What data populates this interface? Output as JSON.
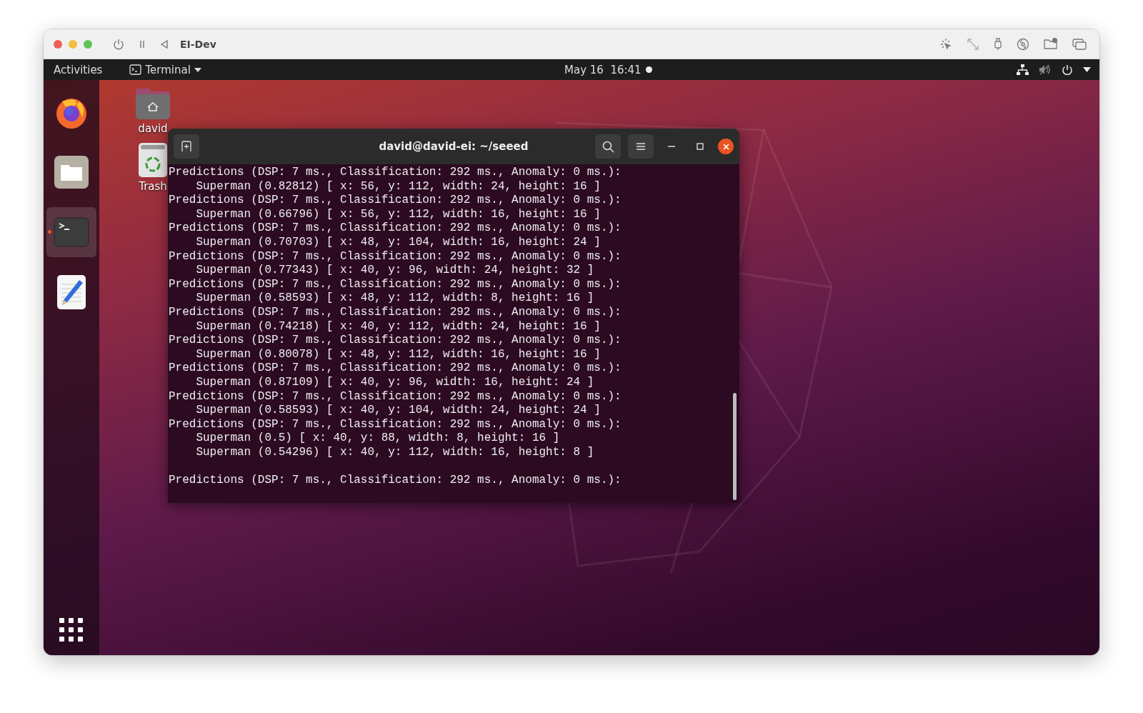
{
  "vm_window": {
    "title": "EI-Dev"
  },
  "top_bar": {
    "activities": "Activities",
    "app_menu": "Terminal",
    "clock": "May 16  16:41"
  },
  "dock": {
    "items": [
      {
        "kind": "browser",
        "selected": false,
        "running": false
      },
      {
        "kind": "files",
        "selected": false,
        "running": false
      },
      {
        "kind": "terminal",
        "selected": true,
        "running": true
      },
      {
        "kind": "editor",
        "selected": false,
        "running": false
      }
    ]
  },
  "desktop_icons": [
    {
      "kind": "home",
      "label": "david"
    },
    {
      "kind": "trash",
      "label": "Trash"
    }
  ],
  "terminal": {
    "title": "david@david-ei: ~/seeed",
    "lines": [
      {
        "text": "Predictions (DSP: 7 ms., Classification: 292 ms., Anomaly: 0 ms.):",
        "blank_before": false
      },
      {
        "text": "    Superman (0.82812) [ x: 56, y: 112, width: 24, height: 16 ]",
        "blank_before": false
      },
      {
        "text": "Predictions (DSP: 7 ms., Classification: 292 ms., Anomaly: 0 ms.):",
        "blank_before": false
      },
      {
        "text": "    Superman (0.66796) [ x: 56, y: 112, width: 16, height: 16 ]",
        "blank_before": false
      },
      {
        "text": "Predictions (DSP: 7 ms., Classification: 292 ms., Anomaly: 0 ms.):",
        "blank_before": false
      },
      {
        "text": "    Superman (0.70703) [ x: 48, y: 104, width: 16, height: 24 ]",
        "blank_before": false
      },
      {
        "text": "Predictions (DSP: 7 ms., Classification: 292 ms., Anomaly: 0 ms.):",
        "blank_before": false
      },
      {
        "text": "    Superman (0.77343) [ x: 40, y: 96, width: 24, height: 32 ]",
        "blank_before": false
      },
      {
        "text": "Predictions (DSP: 7 ms., Classification: 292 ms., Anomaly: 0 ms.):",
        "blank_before": false
      },
      {
        "text": "    Superman (0.58593) [ x: 48, y: 112, width: 8, height: 16 ]",
        "blank_before": false
      },
      {
        "text": "Predictions (DSP: 7 ms., Classification: 292 ms., Anomaly: 0 ms.):",
        "blank_before": false
      },
      {
        "text": "    Superman (0.74218) [ x: 40, y: 112, width: 24, height: 16 ]",
        "blank_before": false
      },
      {
        "text": "Predictions (DSP: 7 ms., Classification: 292 ms., Anomaly: 0 ms.):",
        "blank_before": false
      },
      {
        "text": "    Superman (0.80078) [ x: 48, y: 112, width: 16, height: 16 ]",
        "blank_before": false
      },
      {
        "text": "Predictions (DSP: 7 ms., Classification: 292 ms., Anomaly: 0 ms.):",
        "blank_before": false
      },
      {
        "text": "    Superman (0.87109) [ x: 40, y: 96, width: 16, height: 24 ]",
        "blank_before": false
      },
      {
        "text": "Predictions (DSP: 7 ms., Classification: 292 ms., Anomaly: 0 ms.):",
        "blank_before": false
      },
      {
        "text": "    Superman (0.58593) [ x: 40, y: 104, width: 24, height: 24 ]",
        "blank_before": false
      },
      {
        "text": "Predictions (DSP: 7 ms., Classification: 292 ms., Anomaly: 0 ms.):",
        "blank_before": false
      },
      {
        "text": "    Superman (0.5) [ x: 40, y: 88, width: 8, height: 16 ]",
        "blank_before": false
      },
      {
        "text": "    Superman (0.54296) [ x: 40, y: 112, width: 16, height: 8 ]",
        "blank_before": false
      },
      {
        "text": "Predictions (DSP: 7 ms., Classification: 292 ms., Anomaly: 0 ms.):",
        "blank_before": true
      }
    ]
  }
}
